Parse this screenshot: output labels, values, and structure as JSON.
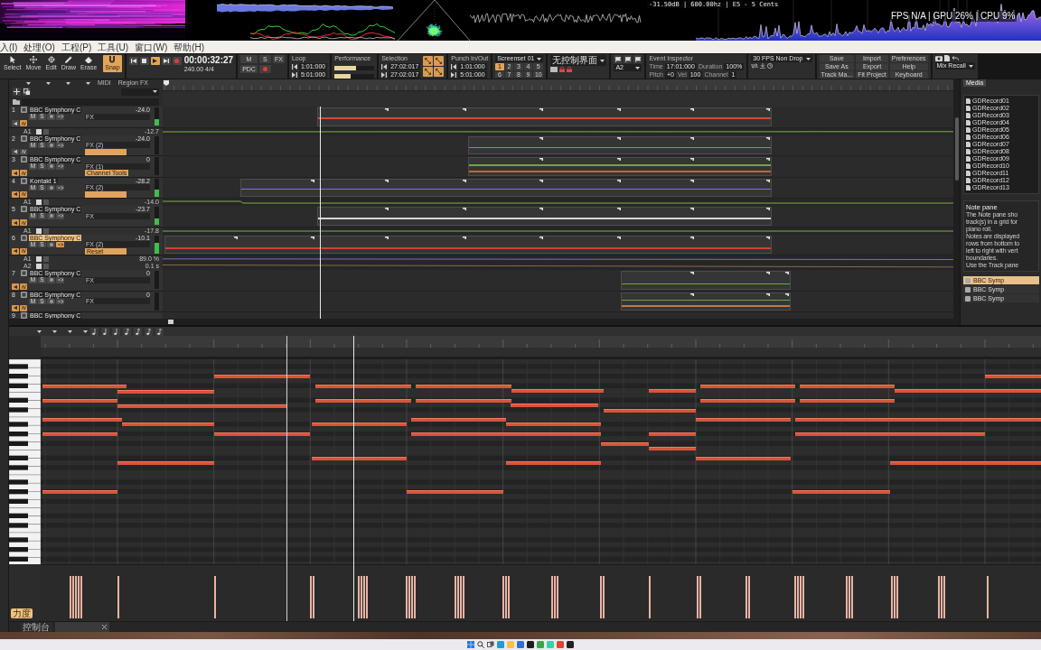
{
  "visualizer": {
    "pitch_readout": "-31.50dB | 600.00hz | E5 - 5 Cents",
    "stats": "FPS N/A | GPU 26% | CPU 9%"
  },
  "menu": [
    "入(I)",
    "处理(O)",
    "工程(P)",
    "工具(U)",
    "窗口(W)",
    "帮助(H)"
  ],
  "control_bar": {
    "tools": [
      {
        "label": "Select",
        "selected": false
      },
      {
        "label": "Move",
        "selected": false
      },
      {
        "label": "Edit",
        "selected": false
      },
      {
        "label": "Draw",
        "selected": false
      },
      {
        "label": "Erase",
        "selected": false
      }
    ],
    "snap": {
      "label": "Snap",
      "on": true
    },
    "transport": {
      "time": "00:00:32:27",
      "tempo": "240.00",
      "meter": "4/4",
      "playing": true
    },
    "mix": [
      "M",
      "S",
      "FX",
      "PDC"
    ],
    "loop": {
      "title": "Loop",
      "start": "1:01:000",
      "end": "5:01:000"
    },
    "performance": {
      "title": "Performance",
      "meters": [
        {
          "level": 0.55
        },
        {
          "level": 0.4
        }
      ]
    },
    "selection": {
      "title": "Selection",
      "start": "27:02:017",
      "end": "27:02:017"
    },
    "punch": {
      "title": "Punch In/Out",
      "start": "1:01:000",
      "end": "5:01:000"
    },
    "screenset": {
      "title": "Screenset 01",
      "slots": [
        {
          "label": "1",
          "selected": true
        },
        {
          "label": "2",
          "selected": false
        },
        {
          "label": "3",
          "selected": false
        },
        {
          "label": "4",
          "selected": false
        },
        {
          "label": "5",
          "selected": false
        },
        {
          "label": "6",
          "selected": false
        },
        {
          "label": "7",
          "selected": false
        },
        {
          "label": "8",
          "selected": false
        },
        {
          "label": "9",
          "selected": false
        },
        {
          "label": "10",
          "selected": false
        }
      ]
    },
    "control_surface": "无控制界面",
    "marker": "A2",
    "event_inspector": {
      "title": "Event Inspector",
      "fields": [
        {
          "label": "Time",
          "value": "17:01:000"
        },
        {
          "label": "Duration",
          "value": "100%"
        },
        {
          "label": "Pitch",
          "value": "+0"
        },
        {
          "label": "Vel",
          "value": "100"
        },
        {
          "label": "Channel",
          "value": "1"
        }
      ]
    },
    "sync": "30 FPS Non Drop",
    "custom_buttons": [
      "Save",
      "Import",
      "Preferences",
      "Save As",
      "Export",
      "Help",
      "Track Ma...",
      "Fit Project",
      "Keyboard"
    ],
    "mix_recall": "Mix Recall"
  },
  "track_view": {
    "menus": [
      "MIDI",
      "Region FX"
    ],
    "tracks": [
      {
        "number": "1",
        "name": "BBC Symphony C",
        "selected": false,
        "volume": "-24.0",
        "fx": "FX",
        "controls": [
          {
            "kind": "mute",
            "label": "M",
            "on": false
          },
          {
            "kind": "solo",
            "label": "S",
            "on": false
          },
          {
            "kind": "arm",
            "on": false
          },
          {
            "kind": "echo",
            "on": false
          }
        ],
        "read": false,
        "write": true,
        "level": 0.35,
        "lanes": [
          {
            "label": "A1",
            "value": "-12.7"
          }
        ]
      },
      {
        "number": "2",
        "name": "BBC Symphony C",
        "selected": false,
        "volume": "-24.0",
        "fx": "FX (2)",
        "plugin_slot": true,
        "controls": [
          {
            "kind": "mute",
            "label": "M",
            "on": false
          },
          {
            "kind": "solo",
            "label": "S",
            "on": false
          },
          {
            "kind": "arm",
            "on": false
          },
          {
            "kind": "echo",
            "on": false
          }
        ],
        "read": false,
        "write": false,
        "level": 0
      },
      {
        "number": "3",
        "name": "BBC Symphony C",
        "selected": false,
        "volume": "0",
        "fx": "FX (1)",
        "plugin": "Channel Tools",
        "controls": [
          {
            "kind": "mute",
            "label": "M",
            "on": false
          },
          {
            "kind": "solo",
            "label": "S",
            "on": false
          },
          {
            "kind": "arm",
            "on": false
          },
          {
            "kind": "echo",
            "on": false
          }
        ],
        "read": true,
        "write": true,
        "level": 0
      },
      {
        "number": "4",
        "name": "Kontakt 1",
        "selected": false,
        "volume": "-28.2",
        "fx": "FX (2)",
        "plugin_slot": true,
        "controls": [
          {
            "kind": "mute",
            "label": "M",
            "on": false
          },
          {
            "kind": "solo",
            "label": "S",
            "on": false
          },
          {
            "kind": "arm",
            "on": false
          },
          {
            "kind": "echo",
            "on": false
          }
        ],
        "read": true,
        "write": true,
        "level": 0.4,
        "lanes": [
          {
            "label": "A1",
            "value": "-14.0"
          }
        ]
      },
      {
        "number": "5",
        "name": "BBC Symphony C",
        "selected": false,
        "volume": "-23.7",
        "fx": "FX",
        "controls": [
          {
            "kind": "mute",
            "label": "M",
            "on": false
          },
          {
            "kind": "solo",
            "label": "S",
            "on": false
          },
          {
            "kind": "arm",
            "on": false
          },
          {
            "kind": "echo",
            "on": false
          }
        ],
        "read": true,
        "write": true,
        "level": 0.35,
        "lanes": [
          {
            "label": "A1",
            "value": "-17.8"
          }
        ]
      },
      {
        "number": "6",
        "name": "BBC Symphony C",
        "selected": true,
        "volume": "-10.1",
        "fx": "FX (2)",
        "plugin": "Reset",
        "controls": [
          {
            "kind": "mute",
            "label": "M",
            "on": false
          },
          {
            "kind": "solo",
            "label": "S",
            "on": false
          },
          {
            "kind": "arm",
            "on": false
          },
          {
            "kind": "echo",
            "on": true
          }
        ],
        "read": true,
        "write": true,
        "level": 0.6,
        "lanes": [
          {
            "label": "A1",
            "value": "89.0 %"
          },
          {
            "label": "A2",
            "value": "0.1 s"
          }
        ]
      },
      {
        "number": "7",
        "name": "BBC Symphony C",
        "selected": false,
        "volume": "0",
        "fx": "FX",
        "controls": [
          {
            "kind": "mute",
            "label": "M",
            "on": false
          },
          {
            "kind": "solo",
            "label": "S",
            "on": false
          },
          {
            "kind": "arm",
            "on": false
          },
          {
            "kind": "echo",
            "on": false
          }
        ],
        "read": true,
        "write": true,
        "level": 0
      },
      {
        "number": "8",
        "name": "BBC Symphony C",
        "selected": false,
        "volume": "0",
        "fx": "FX",
        "controls": [
          {
            "kind": "mute",
            "label": "M",
            "on": false
          },
          {
            "kind": "solo",
            "label": "S",
            "on": false
          },
          {
            "kind": "arm",
            "on": false
          },
          {
            "kind": "echo",
            "on": false
          }
        ],
        "read": true,
        "write": true,
        "level": 0
      },
      {
        "number": "9",
        "name": "BBC Symphony C",
        "selected": false
      }
    ]
  },
  "browser": {
    "tabs": [
      {
        "label": "Media",
        "selected": true
      }
    ],
    "files": [
      "GDRecord01",
      "GDRecord02",
      "GDRecord03",
      "GDRecord04",
      "GDRecord05",
      "GDRecord06",
      "GDRecord07",
      "GDRecord08",
      "GDRecord09",
      "GDRecord10",
      "GDRecord11",
      "GDRecord12",
      "GDRecord13"
    ],
    "help": {
      "title": "Note pane",
      "lines": [
        "The Note pane sho",
        "track(s) in a grid for",
        "piano roll.",
        "Notes are displayed",
        "rows from bottom to",
        "left to right with vert",
        "boundaries.",
        "Use the Track pane"
      ]
    },
    "track_list": [
      {
        "label": "BBC Symp",
        "selected": true
      },
      {
        "label": "BBC Symp",
        "selected": false
      },
      {
        "label": "BBC Symp",
        "selected": false
      }
    ]
  },
  "piano_roll": {
    "controller_button": "力度",
    "tabs": [
      {
        "label": "控制台",
        "selected": false
      },
      {
        "selected": true
      }
    ]
  }
}
